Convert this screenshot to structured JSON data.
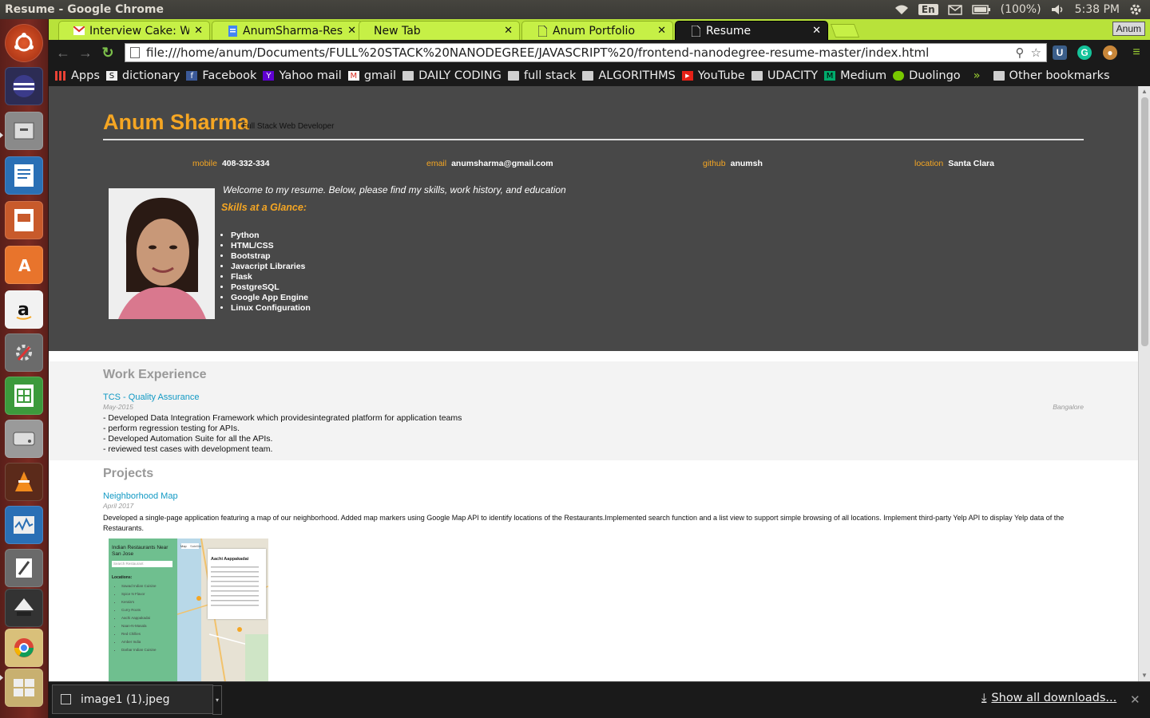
{
  "system": {
    "window_title": "Resume - Google Chrome",
    "language": "En",
    "battery": "(100%)",
    "time": "5:38 PM"
  },
  "launcher": {
    "apps": [
      "ubuntu-dash",
      "eclipse",
      "files",
      "writer",
      "impress",
      "software-center",
      "amazon",
      "system-settings",
      "calc",
      "disk",
      "vlc",
      "system-monitor",
      "text-editor",
      "inkscape",
      "chrome",
      "workspaces",
      "trash"
    ]
  },
  "tabs": [
    {
      "label": "Interview Cake: Wee",
      "icon": "gmail-icon"
    },
    {
      "label": "AnumSharma-Resum",
      "icon": "docs-icon"
    },
    {
      "label": "New Tab",
      "icon": ""
    },
    {
      "label": "Anum Portfolio",
      "icon": "page-icon"
    },
    {
      "label": "Resume",
      "icon": "page-icon"
    }
  ],
  "profile_name": "Anum",
  "omnibox": {
    "url": "file:///home/anum/Documents/FULL%20STACK%20NANODEGREE/JAVASCRIPT%20/frontend-nanodegree-resume-master/index.html"
  },
  "bookmarks": {
    "items": [
      "Apps",
      "dictionary",
      "Facebook",
      "Yahoo mail",
      "gmail",
      "DAILY CODING",
      "full stack",
      "ALGORITHMS",
      "YouTube",
      "UDACITY",
      "Medium",
      "Duolingo"
    ],
    "overflow": "»",
    "other": "Other bookmarks"
  },
  "resume": {
    "name": "Anum Sharma",
    "role": "Full Stack Web Developer",
    "contacts": [
      {
        "key": "mobile",
        "value": "408-332-334"
      },
      {
        "key": "email",
        "value": "anumsharma@gmail.com"
      },
      {
        "key": "github",
        "value": "anumsh"
      },
      {
        "key": "location",
        "value": "Santa Clara"
      }
    ],
    "welcome": "Welcome to my resume. Below, please find my skills, work history, and education",
    "skills_heading": "Skills at a Glance:",
    "skills": [
      "Python",
      "HTML/CSS",
      "Bootstrap",
      "Javacript Libraries",
      "Flask",
      "PostgreSQL",
      "Google App Engine",
      "Linux Configuration"
    ],
    "work": {
      "heading": "Work Experience",
      "title": "TCS - Quality Assurance",
      "date": "May-2015",
      "location": "Bangalore",
      "description": "- Developed Data Integration Framework which providesintegrated platform for application teams\n- perform regression testing for APIs.\n- Developed Automation Suite for all the APIs.\n- reviewed test cases with development team."
    },
    "projects": {
      "heading": "Projects",
      "title": "Neighborhood Map",
      "date": "April 2017",
      "description": "Developed a single-page application featuring a map of our neighborhood. Added map markers using Google Map API to identify locations of the Restaurants.Implemented search function and a list view to support simple browsing of all locations. Implement third-party Yelp API to display Yelp data of the Restaurants.",
      "screenshot": {
        "sidebar_title": "Indian Restaurants Near San Jose",
        "search_placeholder": "Search Restaurant",
        "locations_label": "Locations:",
        "locations": [
          "Sawad Indian Cuisine",
          "Spice N Flavor",
          "Kerala's",
          "Curry Roots",
          "Aachi Aappakadai",
          "Naan-N-Masala",
          "Red Chillies",
          "Amber India",
          "Darbar Indian Cuisine"
        ],
        "map_tabs": [
          "Map",
          "Satellite"
        ],
        "info_title": "Aachi Aappakadai"
      }
    }
  },
  "downloads": {
    "file": "image1 (1).jpeg",
    "show_all": "Show all downloads..."
  },
  "colors": {
    "accent": "#f5a623",
    "link": "#1199c4",
    "header_bg": "#484848",
    "tab_green": "#c6f046"
  }
}
